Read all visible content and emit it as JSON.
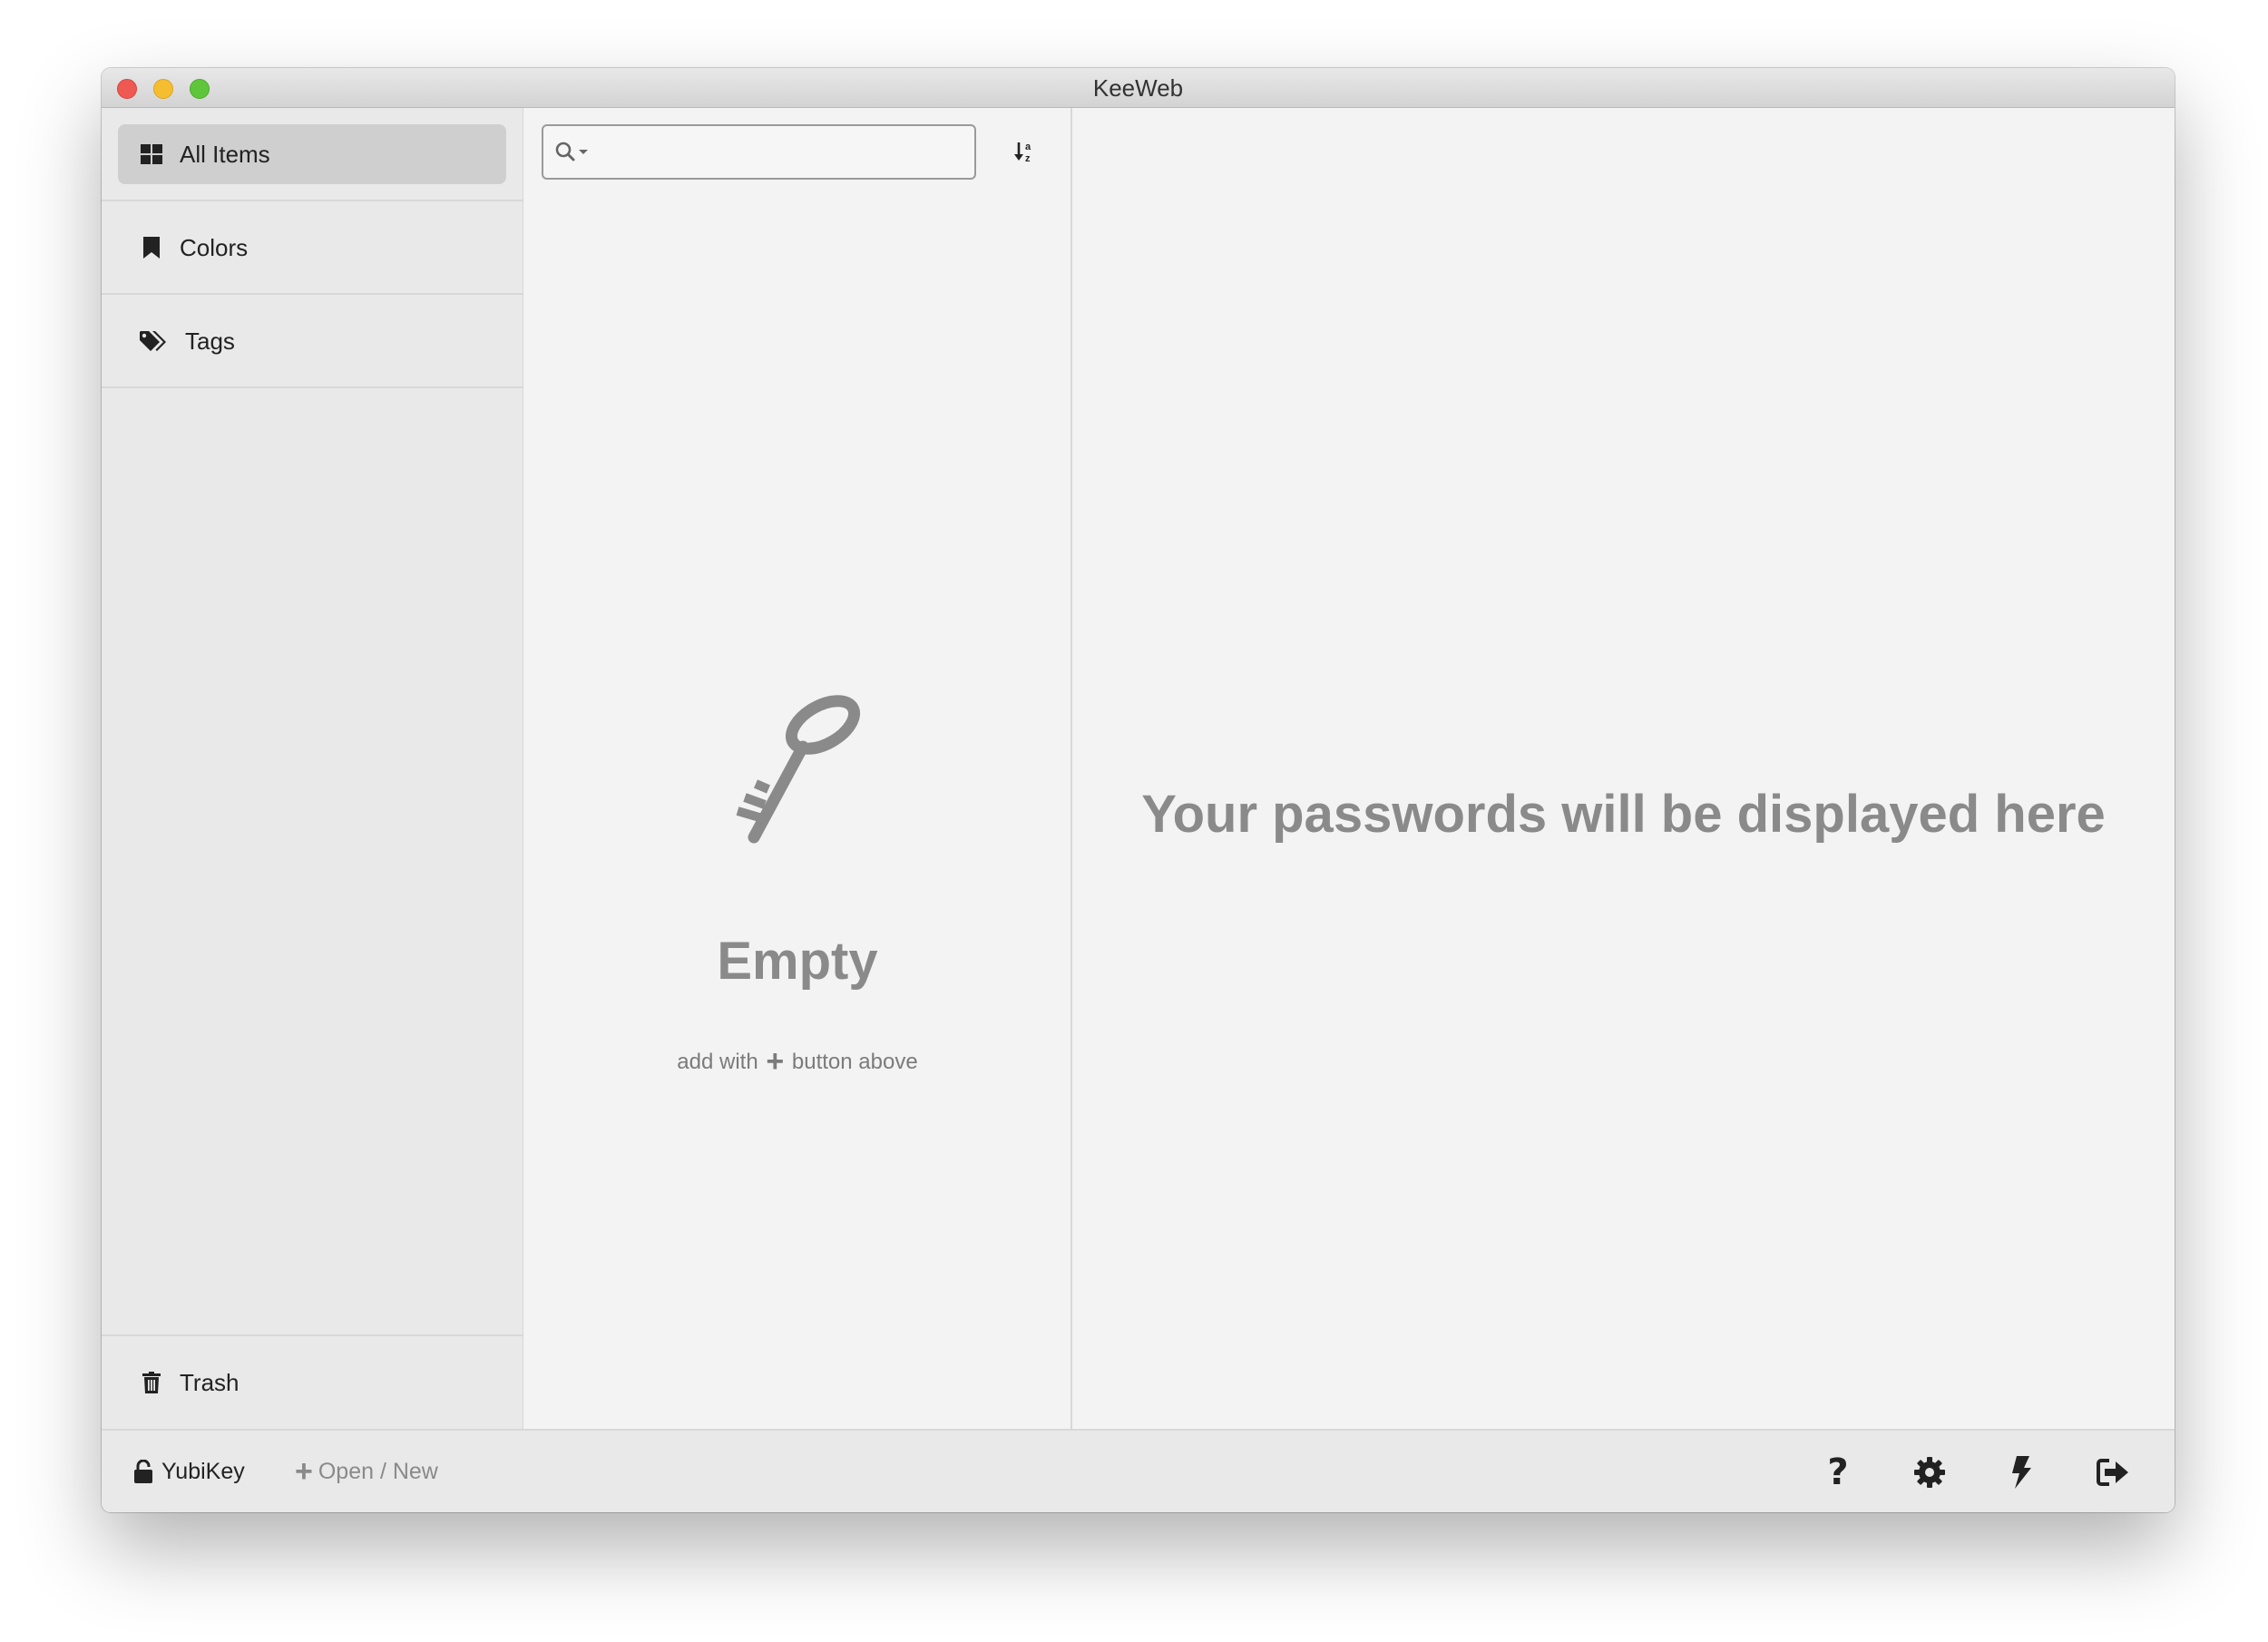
{
  "window": {
    "title": "KeeWeb"
  },
  "menu": {
    "items": [
      {
        "label": "All Items",
        "icon": "grid-icon",
        "active": true
      },
      {
        "label": "Colors",
        "icon": "bookmark-icon",
        "active": false
      },
      {
        "label": "Tags",
        "icon": "tags-icon",
        "active": false
      }
    ],
    "trash": {
      "label": "Trash",
      "icon": "trash-icon"
    }
  },
  "list": {
    "search": {
      "value": "",
      "placeholder": ""
    },
    "empty": {
      "title": "Empty",
      "hint_before": "add with",
      "hint_plus": "+",
      "hint_after": "button above"
    }
  },
  "details": {
    "placeholder": "Your passwords will be displayed here"
  },
  "footer": {
    "yubikey_label": "YubiKey",
    "open_plus": "+",
    "open_label": "Open / New",
    "buttons": [
      "help-icon",
      "settings-icon",
      "generator-icon",
      "lock-exit-icon"
    ]
  },
  "colors": {
    "text_dark": "#222222",
    "text_muted": "#8a8a8a",
    "menu_active": "#cfcfcf",
    "traffic_close": "#ee5a52",
    "traffic_min": "#f5be30",
    "traffic_max": "#5fc63b"
  }
}
